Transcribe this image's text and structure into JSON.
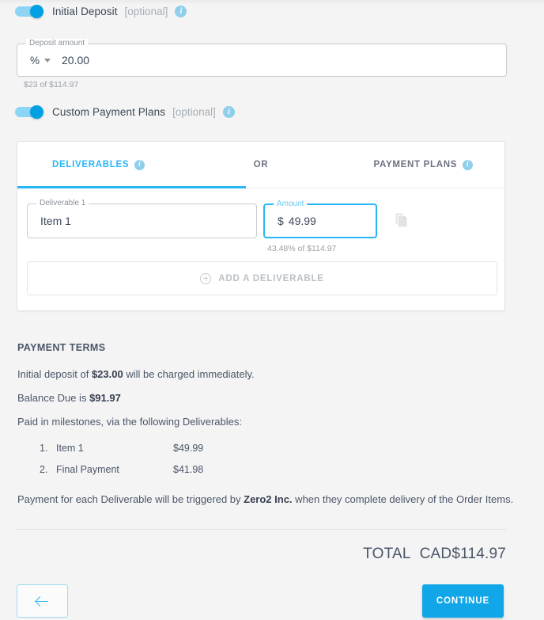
{
  "initial_deposit": {
    "label": "Initial Deposit",
    "optional": "[optional]",
    "info_icon": "info-icon",
    "field_legend": "Deposit amount",
    "unit": "%",
    "amount": "20.00",
    "helper": "$23 of $114.97"
  },
  "custom_payment_plans": {
    "label": "Custom Payment Plans",
    "optional": "[optional]",
    "info_icon": "info-icon",
    "tabs": [
      {
        "label": "DELIVERABLES",
        "active": true,
        "has_info": true
      },
      {
        "label": "OR",
        "active": false,
        "has_info": false
      },
      {
        "label": "PAYMENT PLANS",
        "active": false,
        "has_info": true
      }
    ],
    "deliverable": {
      "name_legend": "Deliverable 1",
      "name_value": "Item 1",
      "amount_legend": "Amount",
      "amount_currency": "$",
      "amount_value": "49.99",
      "amount_helper": "43.48% of $114.97",
      "copy_icon": "copy-icon"
    },
    "add_button": {
      "label": "ADD A DELIVERABLE",
      "icon": "plus-circle-icon"
    }
  },
  "payment_terms": {
    "title": "PAYMENT TERMS",
    "deposit_line_pre": "Initial deposit of ",
    "deposit_amount": "$23.00",
    "deposit_line_post": " will be charged immediately.",
    "balance_line_pre": "Balance Due is ",
    "balance_amount": "$91.97",
    "milestones_intro": "Paid in milestones, via the following Deliverables:",
    "milestones": [
      {
        "num": "1.",
        "name": "Item 1",
        "amount": "$49.99"
      },
      {
        "num": "2.",
        "name": "Final Payment",
        "amount": "$41.98"
      }
    ],
    "trigger_line_pre": "Payment for each Deliverable will be triggered by ",
    "trigger_company": "Zero2 Inc.",
    "trigger_line_post": " when they complete delivery of the Order Items."
  },
  "total": {
    "label": "TOTAL",
    "value": "CAD$114.97"
  },
  "footer": {
    "back_icon": "arrow-left-icon",
    "continue_label": "CONTINUE"
  },
  "colors": {
    "accent": "#29b6f6",
    "continue_bg": "#10a6e8",
    "page_bg": "#f4f4f4",
    "info_badge": "#8ecfeb"
  }
}
